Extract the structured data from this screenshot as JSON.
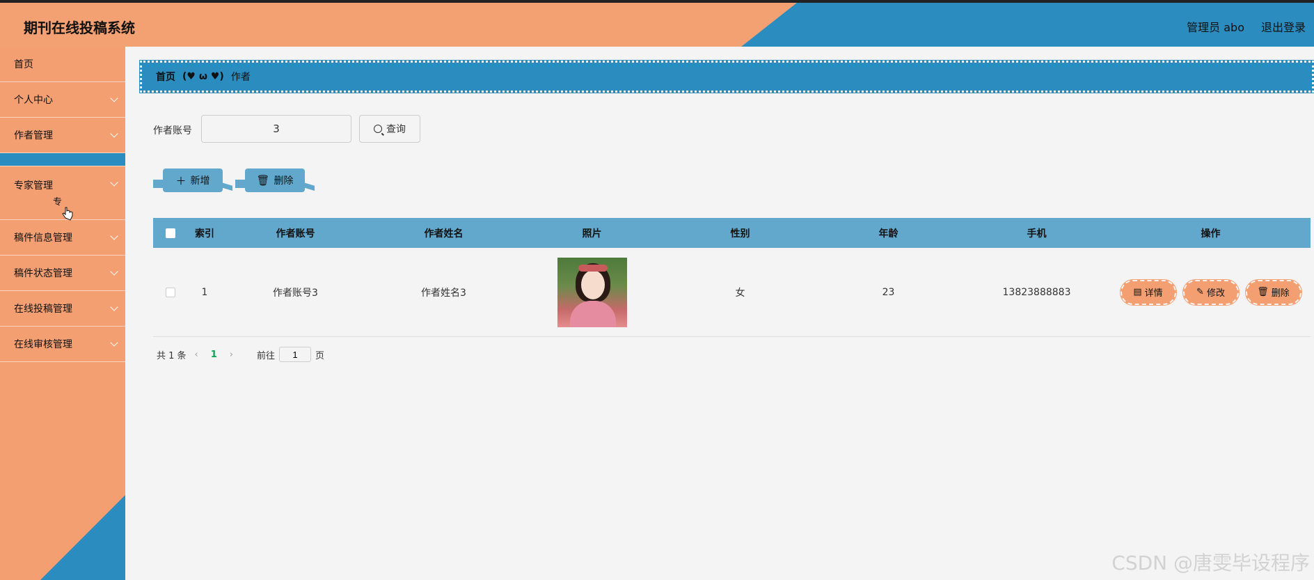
{
  "header": {
    "title": "期刊在线投稿系统",
    "user": "管理员 abo",
    "logout": "退出登录"
  },
  "sidebar": {
    "items": [
      {
        "label": "首页"
      },
      {
        "label": "个人中心"
      },
      {
        "label": "作者管理"
      },
      {
        "label": "专家管理",
        "child": "专"
      },
      {
        "label": "稿件信息管理"
      },
      {
        "label": "稿件状态管理"
      },
      {
        "label": "在线投稿管理"
      },
      {
        "label": "在线审核管理"
      }
    ]
  },
  "breadcrumb": {
    "home": "首页",
    "sep": "(♥ ω ♥)",
    "current": "作者"
  },
  "search": {
    "label": "作者账号",
    "value": "3",
    "button": "查询"
  },
  "actions": {
    "add": "新增",
    "delete": "删除"
  },
  "table": {
    "headers": [
      "索引",
      "作者账号",
      "作者姓名",
      "照片",
      "性别",
      "年龄",
      "手机",
      "操作"
    ],
    "rows": [
      {
        "index": "1",
        "account": "作者账号3",
        "name": "作者姓名3",
        "gender": "女",
        "age": "23",
        "phone": "13823888883"
      }
    ],
    "ops": {
      "detail": "详情",
      "edit": "修改",
      "delete": "删除"
    }
  },
  "pager": {
    "total": "共 1 条",
    "current": "1",
    "goto": "前往",
    "page_value": "1",
    "unit": "页"
  },
  "watermark": "CSDN @唐雯毕设程序",
  "colors": {
    "orange": "#f39f72",
    "blue": "#2b8cc0",
    "table_head": "#62a8cd",
    "pager_active": "#11a057"
  }
}
